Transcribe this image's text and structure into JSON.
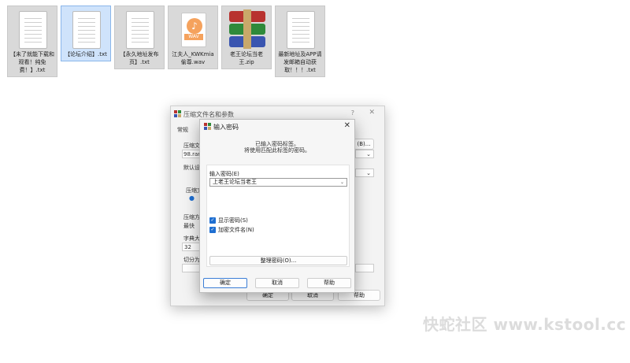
{
  "files": [
    {
      "label": "【未了就能下载和观看！纯免费！】.txt",
      "type": "txt",
      "selected": false
    },
    {
      "label": "【论坛介绍】.txt",
      "type": "txt",
      "selected": true
    },
    {
      "label": "【永久地址发布页】.txt",
      "type": "txt",
      "selected": false
    },
    {
      "label": "江夫人_KWKmia偷尊.wav",
      "type": "wav",
      "selected": false
    },
    {
      "label": "老王论坛当老王.zip",
      "type": "zip",
      "selected": false
    },
    {
      "label": "最新地址及APP请发邮箱自动获取！！！.txt",
      "type": "txt",
      "selected": false
    }
  ],
  "wav_tag": "WAV",
  "back_window": {
    "title": "压缩文件名和参数",
    "help_icon": "?",
    "tab_general": "常规",
    "archive_name_label": "压缩文",
    "archive_name_value": "98.rar",
    "browse_button": "(B)...",
    "default_profile_label": "默认设",
    "format_label": "压缩文",
    "method_label": "压缩方",
    "method_value": "最快",
    "dict_label": "字典大",
    "dict_value": "32",
    "split_label": "切分为",
    "ok": "确定",
    "cancel": "取消",
    "help": "帮助"
  },
  "dialog": {
    "title": "输入密码",
    "message_line1": "已输入密码标签。",
    "message_line2": "将使用匹配此标签的密码。",
    "password_label": "输入密码(E)",
    "password_value": "上老王论坛当老王",
    "show_password": "显示密码(S)",
    "encrypt_filenames": "加密文件名(N)",
    "organize_button": "整理密码(O)...",
    "ok": "确定",
    "cancel": "取消",
    "help": "帮助"
  },
  "watermark": "快蛇社区 www.kstool.cc"
}
